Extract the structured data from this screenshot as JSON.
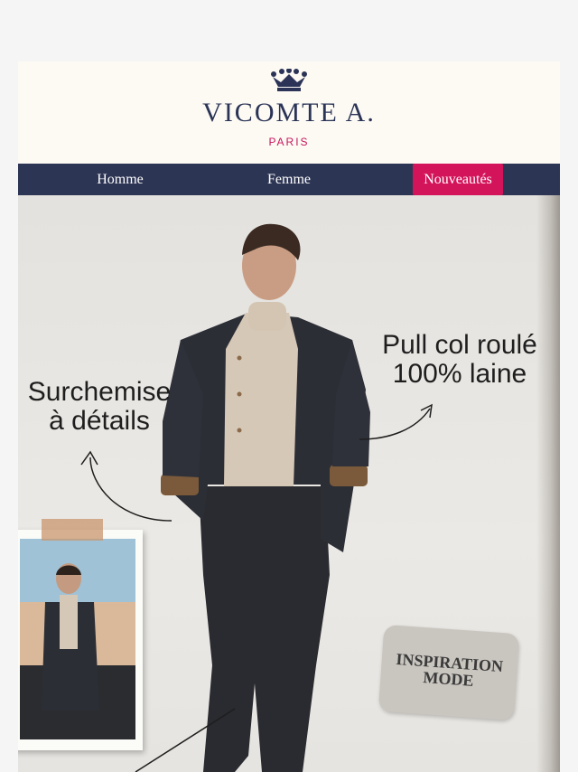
{
  "header": {
    "brand": "VICOMTE A.",
    "city": "PARIS",
    "logo_icon": "crown-icon"
  },
  "nav": {
    "items": [
      {
        "label": "Homme"
      },
      {
        "label": "Femme"
      },
      {
        "label": "Nouveautés",
        "highlight": true
      }
    ]
  },
  "hero": {
    "callout_left": {
      "line1": "Surchemise",
      "line2": "à détails"
    },
    "callout_right": {
      "line1": "Pull col roulé",
      "line2": "100% laine"
    },
    "badge": {
      "line1": "INSPIRATION",
      "line2": "MODE"
    }
  },
  "colors": {
    "navy": "#2d3554",
    "accent": "#d4145a",
    "cream": "#fdfaf4"
  }
}
